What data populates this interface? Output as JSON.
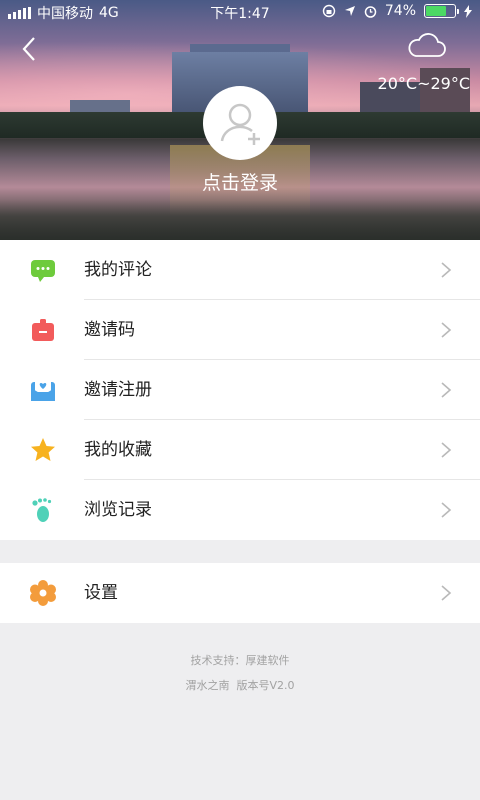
{
  "status_bar": {
    "carrier": "中国移动",
    "network": "4G",
    "time": "下午1:47",
    "battery_percent": "74%",
    "battery_level": 0.74
  },
  "header": {
    "temperature": "20°C~29°C",
    "login_text": "点击登录"
  },
  "menu": {
    "items": [
      {
        "label": "我的评论",
        "icon": "comment-icon",
        "color": "#6ecb3c"
      },
      {
        "label": "邀请码",
        "icon": "badge-icon",
        "color": "#f25b5b"
      },
      {
        "label": "邀请注册",
        "icon": "envelope-heart-icon",
        "color": "#4aa3e8"
      },
      {
        "label": "我的收藏",
        "icon": "star-icon",
        "color": "#f7b21f"
      },
      {
        "label": "浏览记录",
        "icon": "footprint-icon",
        "color": "#4fd1b8"
      }
    ]
  },
  "settings": {
    "label": "设置",
    "icon": "gear-icon",
    "color": "#f39c3c"
  },
  "footer": {
    "support": "技术支持：厚建软件",
    "version": "渭水之南  版本号V2.0"
  }
}
